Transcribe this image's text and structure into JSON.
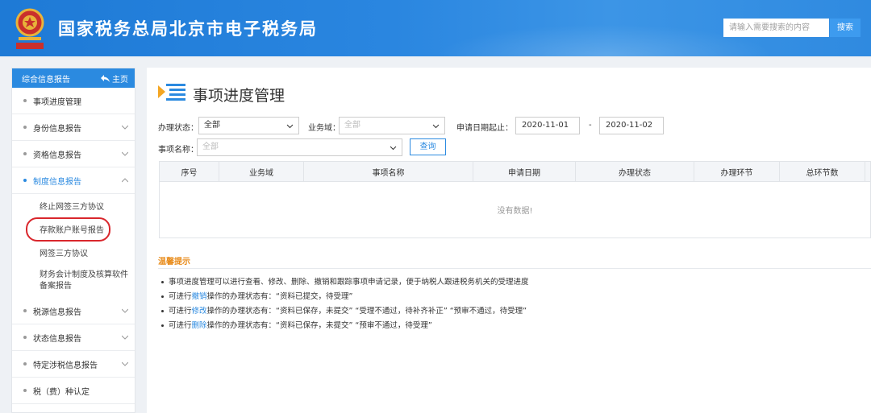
{
  "header": {
    "site_title": "国家税务总局北京市电子税务局",
    "search_placeholder": "请输入需要搜索的内容",
    "search_button": "搜索"
  },
  "sidebar": {
    "head_title": "综合信息报告",
    "home_label": "主页",
    "items": [
      {
        "label": "事项进度管理",
        "expandable": false
      },
      {
        "label": "身份信息报告",
        "expandable": true
      },
      {
        "label": "资格信息报告",
        "expandable": true
      },
      {
        "label": "制度信息报告",
        "expandable": true,
        "expanded": true
      },
      {
        "label": "税源信息报告",
        "expandable": true
      },
      {
        "label": "状态信息报告",
        "expandable": true
      },
      {
        "label": "特定涉税信息报告",
        "expandable": true
      },
      {
        "label": "税（费）种认定",
        "expandable": false
      }
    ],
    "sub_items": [
      {
        "label": "终止网签三方协议"
      },
      {
        "label": "存款账户账号报告"
      },
      {
        "label": "网签三方协议"
      },
      {
        "label": "财务会计制度及核算软件备案报告"
      }
    ]
  },
  "main": {
    "page_title": "事项进度管理",
    "filters": {
      "status_label": "办理状态：",
      "status_value": "全部",
      "domain_label": "业务域：",
      "domain_value": "全部",
      "date_label": "申请日期起止：",
      "date_start": "2020-11-01",
      "date_separator": "-",
      "date_end": "2020-11-02",
      "item_label": "事项名称：",
      "item_value": "全部",
      "query_button": "查询"
    },
    "table": {
      "columns": [
        "序号",
        "业务域",
        "事项名称",
        "申请日期",
        "办理状态",
        "办理环节",
        "总环节数"
      ],
      "empty_text": "没有数据!"
    },
    "tips": {
      "title": "温馨提示",
      "line1": "事项进度管理可以进行查看、修改、删除、撤销和跟踪事项申请记录，便于纳税人跟进税务机关的受理进度",
      "line2_prefix": "可进行",
      "line2_action": "撤销",
      "line2_suffix": "操作的办理状态有：“资料已提交，待受理”",
      "line3_prefix": "可进行",
      "line3_action": "修改",
      "line3_suffix": "操作的办理状态有：“资料已保存，未提交” “受理不通过，待补齐补正” “预审不通过，待受理”",
      "line4_prefix": "可进行",
      "line4_action": "删除",
      "line4_suffix": "操作的办理状态有：“资料已保存，未提交” “预审不通过，待受理”"
    }
  },
  "colors": {
    "header_blue": "#2b8ae0",
    "link_blue": "#2b8ae0",
    "tip_orange": "#e88b1a",
    "highlight_red": "#d9262c"
  }
}
